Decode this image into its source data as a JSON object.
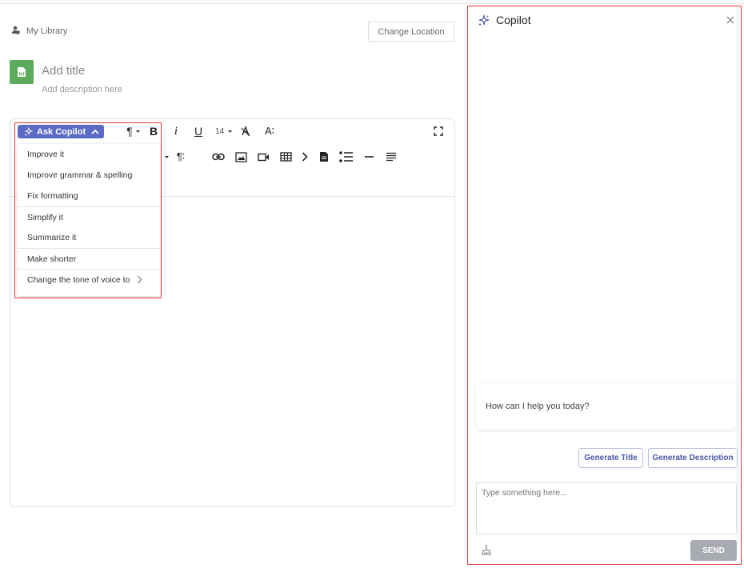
{
  "header": {
    "library_label": "My Library",
    "change_location_label": "Change Location"
  },
  "document": {
    "title_placeholder": "Add title",
    "description_placeholder": "Add description here"
  },
  "toolbar": {
    "ask_copilot_label": "Ask Copilot",
    "paragraph_glyph": "¶",
    "bold_glyph": "B",
    "italic_glyph": "i",
    "underline_glyph": "U",
    "font_size": "14",
    "line_height_glyph": "A∶",
    "paragraph_format_glyph": "¶∶"
  },
  "copilot_menu": {
    "items": [
      {
        "label": "Improve it"
      },
      {
        "label": "Improve grammar & spelling"
      },
      {
        "label": "Fix formatting"
      },
      {
        "label": "Simplify it"
      },
      {
        "label": "Summarize it"
      },
      {
        "label": "Make shorter"
      },
      {
        "label": "Change the tone of voice to"
      }
    ]
  },
  "copilot_panel": {
    "title": "Copilot",
    "assistant_message": "How can I help you today?",
    "generate_title_label": "Generate Title",
    "generate_description_label": "Generate Description",
    "input_placeholder": "Type something here...",
    "send_label": "SEND"
  },
  "colors": {
    "accent": "#5b6ac4",
    "highlight_border": "#e03a3a",
    "doc_icon": "#5cab5a",
    "send_disabled": "#a9abb3"
  }
}
